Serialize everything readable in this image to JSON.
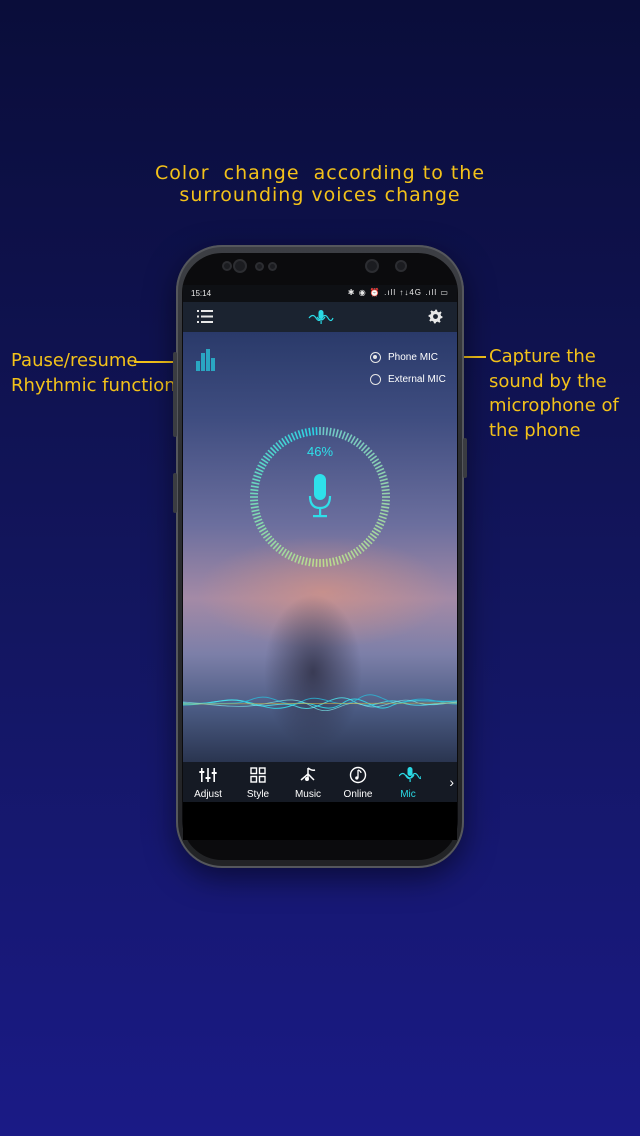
{
  "headline": {
    "line1": "Color  change  according to the",
    "line2": "surrounding voices change"
  },
  "annotations": {
    "left_line1": "Pause/resume",
    "left_line2": "Rhythmic function",
    "right_line1": "Capture the",
    "right_line2": "sound by the",
    "right_line3": "microphone of",
    "right_line4": "the phone"
  },
  "status_bar": {
    "time": "15:14",
    "icons": "✱ ◉ ⏰ .ıll ↑↓4G .ıll ▭"
  },
  "app_bar": {
    "menu_icon": "menu-icon",
    "logo_icon": "mic-wave-logo-icon",
    "settings_icon": "gear-icon"
  },
  "mic_source": {
    "options": [
      {
        "label": "Phone MIC",
        "selected": true
      },
      {
        "label": "External MIC",
        "selected": false
      }
    ]
  },
  "level_meter": {
    "percent_label": "46%",
    "level": 0.46
  },
  "nav": {
    "items": [
      {
        "label": "Adjust",
        "icon": "sliders-icon",
        "active": false
      },
      {
        "label": "Style",
        "icon": "grid-icon",
        "active": false
      },
      {
        "label": "Music",
        "icon": "music-note-icon",
        "active": false
      },
      {
        "label": "Online",
        "icon": "online-music-icon",
        "active": false
      },
      {
        "label": "Mic",
        "icon": "mic-icon",
        "active": true
      }
    ],
    "more_glyph": "›"
  },
  "colors": {
    "accent": "#2ad9e4",
    "annotation": "#f3c21a"
  }
}
